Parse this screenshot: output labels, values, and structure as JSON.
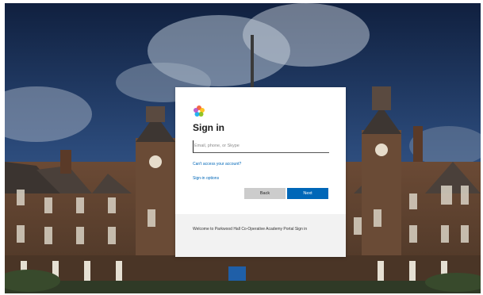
{
  "signin": {
    "title": "Sign in",
    "email_placeholder": "Email, phone, or Skype",
    "cant_access_link": "Can't access your account?",
    "sign_in_options_link": "Sign-in options",
    "back_label": "Back",
    "next_label": "Next"
  },
  "footer": {
    "welcome_text": "Welcome to Parkwood Hall Co-Operative Academy Portal Sign in"
  },
  "colors": {
    "accent": "#0067b8",
    "back_button": "#cccccc",
    "footer_bg": "#f2f2f2"
  },
  "icons": {
    "logo": "pinwheel-logo-icon"
  }
}
